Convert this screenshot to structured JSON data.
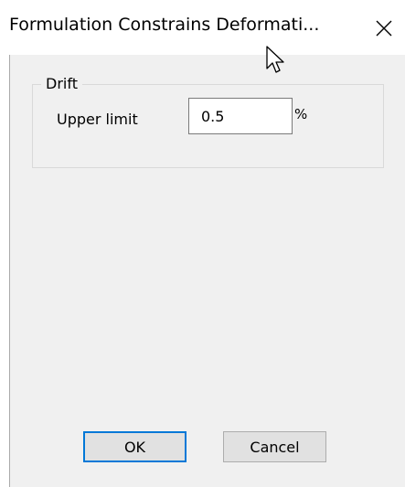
{
  "window": {
    "title": "Formulation Constrains Deformati...",
    "close_icon": "close-icon"
  },
  "drift_group": {
    "legend": "Drift",
    "upper_limit_label": "Upper limit",
    "upper_limit_value": "0.5",
    "unit": "%"
  },
  "buttons": {
    "ok_label": "OK",
    "cancel_label": "Cancel"
  },
  "colors": {
    "client_background": "#f0f0f0",
    "focus_border": "#0078d7",
    "button_face": "#e1e1e1"
  }
}
